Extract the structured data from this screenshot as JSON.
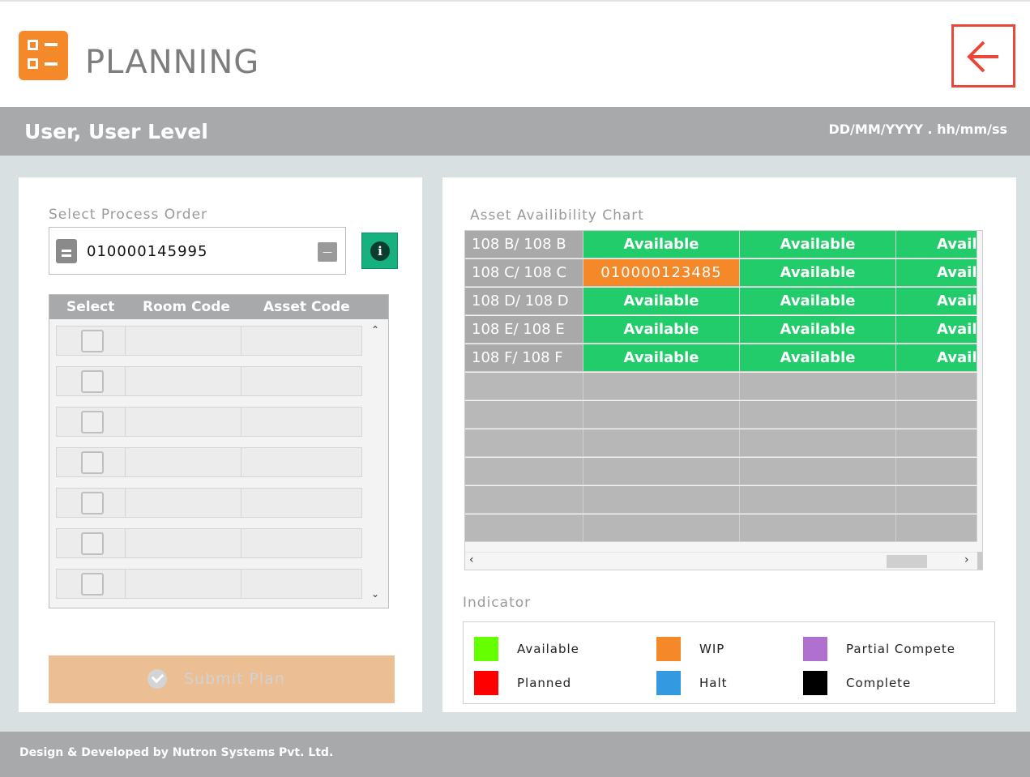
{
  "app": {
    "title": "PLANNING"
  },
  "userbar": {
    "user": "User, User Level",
    "datetime": "DD/MM/YYYY . hh/mm/ss"
  },
  "process_order": {
    "label": "Select Process Order",
    "value": "010000145995"
  },
  "asset_table": {
    "columns": [
      "Select",
      "Room Code",
      "Asset Code"
    ],
    "row_count": 7
  },
  "submit": {
    "label": "Submit Plan"
  },
  "chart": {
    "title": "Asset Availibility Chart",
    "rows": [
      {
        "label": "108 B/ 108 B",
        "cells": [
          "Available",
          "Available",
          "Avail"
        ]
      },
      {
        "label": "108 C/ 108 C",
        "cells": [
          "010000123485",
          "Available",
          "Avail"
        ]
      },
      {
        "label": "108 D/ 108 D",
        "cells": [
          "Available",
          "Available",
          "Avail"
        ]
      },
      {
        "label": "108 E/ 108 E",
        "cells": [
          "Available",
          "Available",
          "Avail"
        ]
      },
      {
        "label": "108 F/ 108 F",
        "cells": [
          "Available",
          "Available",
          "Avail"
        ]
      }
    ]
  },
  "indicator": {
    "title": "Indicator",
    "items": [
      {
        "label": "Available",
        "color": "#66ff00"
      },
      {
        "label": "WIP",
        "color": "#f5892a"
      },
      {
        "label": "Partial Compete",
        "color": "#b070d0"
      },
      {
        "label": "Planned",
        "color": "#ff0000"
      },
      {
        "label": "Halt",
        "color": "#3399e0"
      },
      {
        "label": "Complete",
        "color": "#000000"
      }
    ]
  },
  "footer": {
    "text": "Design & Developed by Nutron Systems Pvt. Ltd."
  }
}
